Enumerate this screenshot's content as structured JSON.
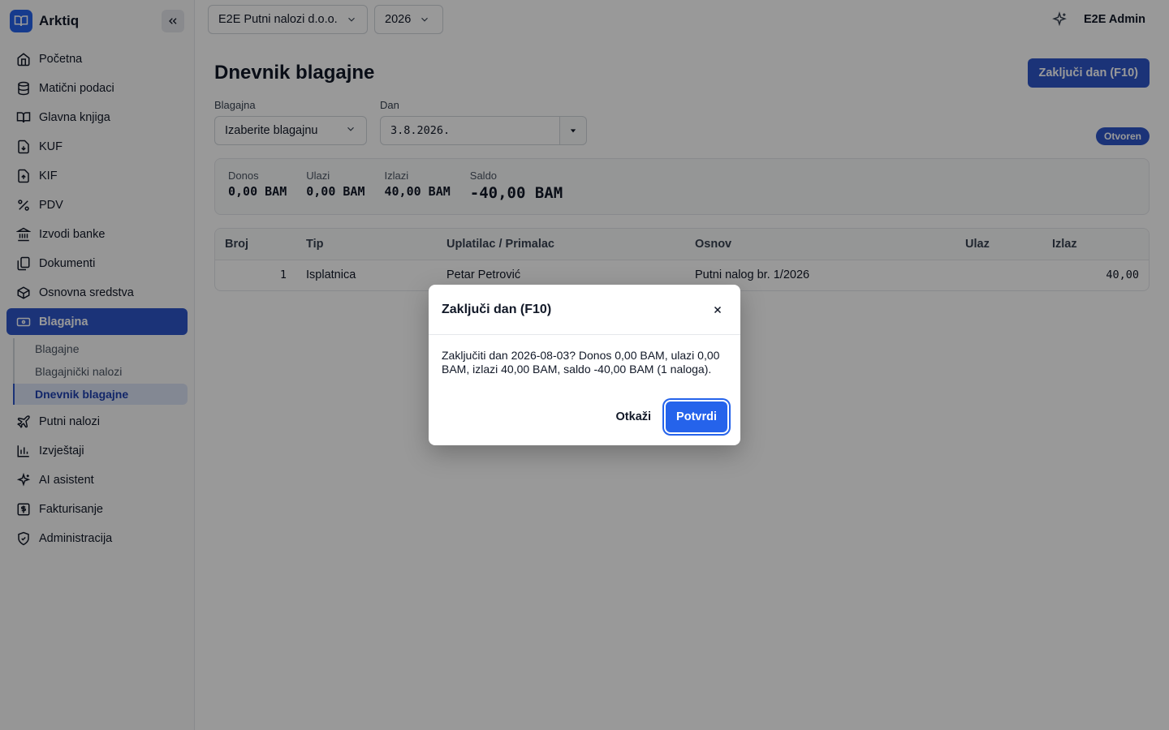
{
  "app": {
    "name": "Arktiq"
  },
  "sidebar": {
    "items": [
      {
        "label": "Početna",
        "icon": "home-icon"
      },
      {
        "label": "Matični podaci",
        "icon": "database-icon"
      },
      {
        "label": "Glavna knjiga",
        "icon": "book-icon"
      },
      {
        "label": "KUF",
        "icon": "file-download-icon"
      },
      {
        "label": "KIF",
        "icon": "file-upload-icon"
      },
      {
        "label": "PDV",
        "icon": "percent-icon"
      },
      {
        "label": "Izvodi banke",
        "icon": "bank-icon"
      },
      {
        "label": "Dokumenti",
        "icon": "files-icon"
      },
      {
        "label": "Osnovna sredstva",
        "icon": "box-icon"
      },
      {
        "label": "Blagajna",
        "icon": "cash-icon"
      }
    ],
    "subitems": [
      {
        "label": "Blagajne"
      },
      {
        "label": "Blagajnički nalozi"
      },
      {
        "label": "Dnevnik blagajne"
      }
    ],
    "items_after": [
      {
        "label": "Putni nalozi",
        "icon": "plane-icon"
      },
      {
        "label": "Izvještaji",
        "icon": "bar-chart-icon"
      },
      {
        "label": "AI asistent",
        "icon": "sparkles-icon"
      },
      {
        "label": "Fakturisanje",
        "icon": "invoice-icon"
      },
      {
        "label": "Administracija",
        "icon": "shield-icon"
      }
    ]
  },
  "topbar": {
    "company": "E2E Putni nalozi d.o.o.",
    "year": "2026",
    "user": "E2E Admin"
  },
  "page": {
    "title": "Dnevnik blagajne",
    "close_day_button": "Zaključi dan (F10)",
    "status": "Otvoren"
  },
  "filters": {
    "register_label": "Blagajna",
    "register_value": "Izaberite blagajnu",
    "day_label": "Dan",
    "day_value": "3.8.2026."
  },
  "summary": {
    "carry_label": "Donos",
    "carry_value": "0,00 BAM",
    "in_label": "Ulazi",
    "in_value": "0,00 BAM",
    "out_label": "Izlazi",
    "out_value": "40,00 BAM",
    "balance_label": "Saldo",
    "balance_value": "-40,00 BAM"
  },
  "table": {
    "headers": [
      "Broj",
      "Tip",
      "Uplatilac / Primalac",
      "Osnov",
      "Ulaz",
      "Izlaz"
    ],
    "rows": [
      {
        "broj": "1",
        "tip": "Isplatnica",
        "party": "Petar Petrović",
        "osnov": "Putni nalog br. 1/2026",
        "ulaz": "",
        "izlaz": "40,00"
      }
    ]
  },
  "modal": {
    "title": "Zaključi dan (F10)",
    "body": "Zaključiti dan 2026-08-03? Donos 0,00 BAM, ulazi 0,00 BAM, izlazi 40,00 BAM, saldo -40,00 BAM (1 naloga).",
    "cancel": "Otkaži",
    "confirm": "Potvrdi"
  }
}
